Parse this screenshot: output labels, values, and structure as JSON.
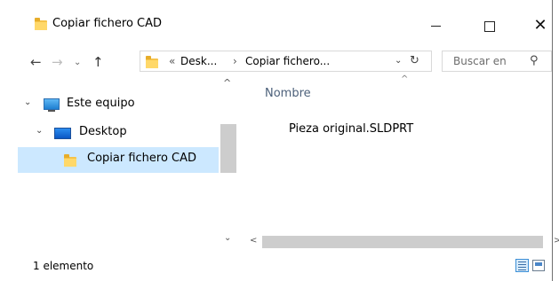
{
  "window": {
    "title": "Copiar fichero CAD",
    "close_glyph": "✕"
  },
  "navigation": {
    "back_icon": "←",
    "forward_icon": "→",
    "recent_icon": "⌄",
    "up_icon": "↑"
  },
  "address_bar": {
    "overflow_glyph": "«",
    "segments": [
      "Desk...",
      "Copiar fichero..."
    ],
    "separator": "›",
    "dropdown_glyph": "⌄",
    "refresh_glyph": "↻"
  },
  "search": {
    "placeholder": "Buscar en",
    "icon_glyph": "⚲"
  },
  "nav_pane": {
    "items": [
      {
        "label": "Este equipo",
        "icon": "computer-icon",
        "expanded": true
      },
      {
        "label": "Desktop",
        "icon": "desktop-icon",
        "expanded": true
      },
      {
        "label": "Copiar fichero CAD",
        "icon": "folder-icon",
        "selected": true
      }
    ],
    "expand_glyph": "⌄"
  },
  "content": {
    "column_header": "Nombre",
    "sort_glyph": "^",
    "files": [
      {
        "name": "Pieza original.SLDPRT"
      }
    ]
  },
  "scrollbars": {
    "up": "^",
    "down": "⌄",
    "left": "<",
    "right": ">"
  },
  "status_bar": {
    "item_count": "1 elemento"
  },
  "colors": {
    "selection": "#cce8ff",
    "folder": "#ffd869",
    "header_text": "#4c607a"
  }
}
